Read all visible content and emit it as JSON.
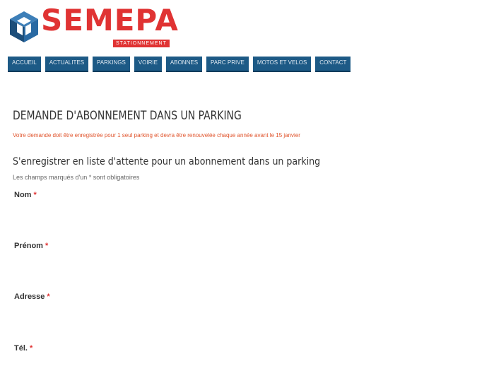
{
  "header": {
    "brand": "SEMEPA",
    "tagline": "STATIONNEMENT"
  },
  "nav": [
    {
      "label": "ACCUEIL"
    },
    {
      "label": "ACTUALITES"
    },
    {
      "label": "PARKINGS"
    },
    {
      "label": "VOIRIE"
    },
    {
      "label": "ABONNES"
    },
    {
      "label": "PARC PRIVE"
    },
    {
      "label": "MOTOS ET VELOS"
    },
    {
      "label": "CONTACT"
    }
  ],
  "page": {
    "title": "DEMANDE D'ABONNEMENT DANS UN PARKING",
    "notice": "Votre demande doit être enregistrée pour 1 seul parking et devra être renouvelée chaque année avant le 15 janvier",
    "subtitle": "S'enregistrer en liste d'attente pour un abonnement dans un parking",
    "required_note": "Les champs marqués d'un * sont obligatoires"
  },
  "form": {
    "required_marker": "*",
    "fields": [
      {
        "label": "Nom",
        "value": ""
      },
      {
        "label": "Prénom",
        "value": ""
      },
      {
        "label": "Adresse",
        "value": ""
      },
      {
        "label": "Tél.",
        "value": ""
      }
    ]
  },
  "colors": {
    "brand_red": "#e03333",
    "nav_blue": "#1d5a86",
    "notice_orange": "#e0542c"
  }
}
